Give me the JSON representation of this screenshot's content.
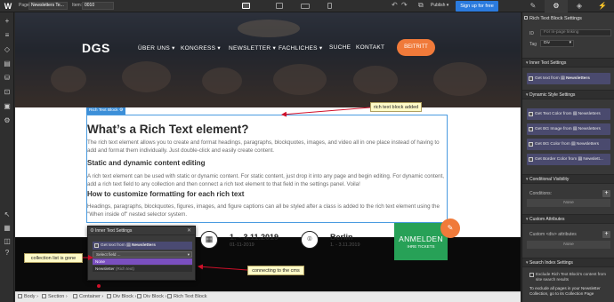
{
  "topbar": {
    "page_label": "Page:",
    "page_value": "Newsletters Te...",
    "item_label": "Item:",
    "item_value": "0010",
    "publish_label": "Publish",
    "signup_label": "Sign up for free"
  },
  "hero": {
    "brand": "DGS",
    "nav": [
      "ÜBER UNS ▾",
      "KONGRESS ▾",
      "NEWSLETTER ▾",
      "FACHLICHES ▾",
      "SUCHE",
      "KONTAKT"
    ],
    "cta": "BEITRITT"
  },
  "richtext": {
    "tag_label": "Rich Text Block",
    "h1": "What’s a Rich Text element?",
    "p1": "The rich text element allows you to create and format headings, paragraphs, blockquotes, images, and video all in one place instead of having to add and format them individually. Just double-click and easily create content.",
    "h2a": "Static and dynamic content editing",
    "p2": "A rich text element can be used with static or dynamic content. For static content, just drop it into any page and begin editing. For dynamic content, add a rich text field to any collection and then connect a rich text element to that field in the settings panel. Voila!",
    "h2b": "How to customize formatting for each rich text",
    "p3": "Headings, paragraphs, blockquotes, figures, images, and figure captions can all be styled after a class is added to the rich text element using the \"When inside of\" nested selector system."
  },
  "events": {
    "date1": "1. - 3.11.2019",
    "sub1": "01-11-2019",
    "city": "Berlin",
    "sub2": "1. - 3.11.2019",
    "anmelden": "ANMELDEN",
    "tickets": "IHRE TICKETS"
  },
  "popup": {
    "title": "Inner Text Settings",
    "row_label": "Get text from",
    "row_source": "Newsletters",
    "select_placeholder": "Select field ...",
    "option_selected": "None",
    "option_other": "Newsletter",
    "option_other_hint": "(Rich text)"
  },
  "notes": {
    "rich_text": "rich text block added",
    "collection": "collection list is gone",
    "cms": "connecting to the cms"
  },
  "breadcrumb": [
    "Body",
    "Section",
    "Container",
    "Div Block",
    "Div Block",
    "Rich Text Block"
  ],
  "panel": {
    "title": "Rich Text Block Settings",
    "id_label": "ID",
    "id_placeholder": "For in-page linking",
    "tag_label": "Tag",
    "tag_value": "Div",
    "inner_text_section": "Inner Text Settings",
    "inner_text_card": "Get text from",
    "inner_text_source": "Newsletters",
    "dynamic_style_section": "Dynamic Style Settings",
    "style_cards": [
      {
        "label": "Get Text Color from",
        "source": "Newsletters"
      },
      {
        "label": "Get BG Image from",
        "source": "Newsletters"
      },
      {
        "label": "Get BG Color from",
        "source": "Newsletters"
      },
      {
        "label": "Get Border Color from",
        "source": "Newslett..."
      }
    ],
    "visibility_section": "Conditional Visibility",
    "conditions_label": "Conditions:",
    "none_label": "None",
    "custom_attr_section": "Custom Attributes",
    "custom_attr_label": "Custom <div> attributes",
    "none_label2": "None",
    "search_section": "Search Index Settings",
    "exclude_text": "Exclude Rich Text Block's content from site search results",
    "include_text": "To exclude all pages in your Newsletter Collection, go to its Collection Page"
  },
  "colors": {
    "accent": "#2b7bde",
    "brand_orange": "#f07a3a",
    "green": "#27a157",
    "selection_purple": "#7a4fbf",
    "annotation_arrow": "#d0102a",
    "annotation_bg": "#fffbc8"
  }
}
